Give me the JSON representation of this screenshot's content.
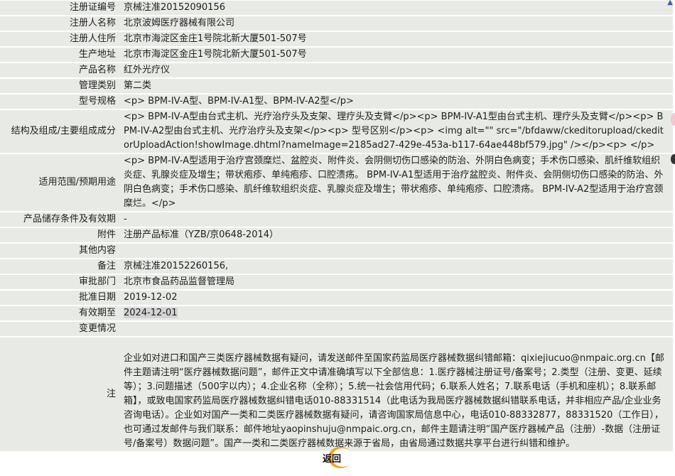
{
  "rows": [
    {
      "label": "注册证编号",
      "value": "京械注准20152090156"
    },
    {
      "label": "注册人名称",
      "value": "北京波姆医疗器械有限公司"
    },
    {
      "label": "注册人住所",
      "value": "北京市海淀区金庄1号院北新大厦501-507号"
    },
    {
      "label": "生产地址",
      "value": "北京市海淀区金庄1号院北新大厦501-507号"
    },
    {
      "label": "产品名称",
      "value": "红外光疗仪"
    },
    {
      "label": "管理类别",
      "value": "第二类"
    },
    {
      "label": "型号规格",
      "value": "<p> BPM-IV-A型、BPM-IV-A1型、BPM-IV-A2型</p>"
    },
    {
      "label": "结构及组成/主要组成成分",
      "value": "<p> BPM-IV-A型由台式主机、光疗治疗头及支架、理疗头及支臂</p><p> BPM-IV-A1型由台式主机、理疗头及支臂</p><p> BPM-IV-A2型由台式主机、光疗治疗头及支架</p><p> 型号区别</p><p> <img alt=\"\" src=\"/bfdaww/ckeditorupload/ckeditorUploadAction!showImage.dhtml?nameImage=2185ad27-429e-453a-b117-64ae448bf579.jpg\" /></p><p> </p>"
    },
    {
      "label": "适用范围/预期用途",
      "value": "<p> BPM-IV-A型适用于治疗宫颈糜烂、盆腔炎、附件炎、会阴侧切伤口感染的防治、外阴白色病变；手术伤口感染、肌纤维软组织炎症、乳腺炎症及增生；带状疱疹、单纯疱疹、口腔溃疡。 BPM-IV-A1型适用于治疗盆腔炎、附件炎、会阴侧切伤口感染的防治、外阴白色病变；手术伤口感染、肌纤维软组织炎症、乳腺炎症及增生；带状疱疹、单纯疱疹、口腔溃疡。 BPM-IV-A2型适用于治疗宫颈糜烂。</p>"
    },
    {
      "label": "产品储存条件及有效期",
      "value": "-"
    },
    {
      "label": "附件",
      "value": "注册产品标准（YZB/京0648-2014）"
    },
    {
      "label": "其他内容",
      "value": ""
    },
    {
      "label": "备注",
      "value": "京械注准20152260156,"
    },
    {
      "label": "审批部门",
      "value": "北京市食品药品监督管理局"
    },
    {
      "label": "批准日期",
      "value": "2019-12-02"
    },
    {
      "label": "有效期至",
      "value": "2024-12-01"
    },
    {
      "label": "变更情况",
      "value": ""
    }
  ],
  "notice": {
    "label": "注",
    "text": "企业如对进口和国产三类医疗器械数据有疑问，请发送邮件至国家药监局医疗器械数据纠错邮箱：qixiejiucuo@nmpaic.org.cn【邮件主题请注明“医疗器械数据问题”，邮件正文中请准确填写以下全部信息：1.医疗器械注册证号/备案号；2.类型（注册、变更、延续等）；3.问题描述（500字以内）；4.企业名称（全称）；5.统一社会信用代码；6.联系人姓名；7.联系电话（手机和座机）；8.联系邮箱】，或致电国家药监局医疗器械数据纠错电话010-88331514（此电话为我局医疗器械数据纠错联系电话，并非相应产品/企业业务咨询电话）。企业如对国产一类和二类医疗器械数据有疑问，请咨询国家局信息中心，电话010-88332877，88331520（工作日），也可通过发邮件与我们联系：邮件地址yaopinshuju@nmpaic.org.cn，邮件主题请注明“国产医疗器械产品（注册）-数据（注册证号/备案号）数据问题”。国产一类和二类医疗器械数据来源于省局，由省局通过数据共享平台进行纠错和维护。"
  },
  "footer": {
    "back_label": "返回"
  },
  "colors": {
    "row_bg": "#e8eae6",
    "highlight": "#d3d3d3",
    "back_ring": "#f2a21a"
  }
}
